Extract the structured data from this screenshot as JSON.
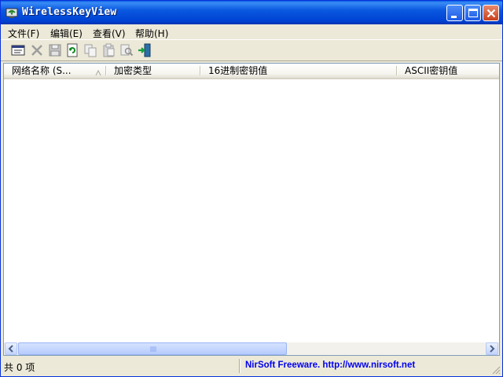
{
  "window": {
    "title": "WirelessKeyView",
    "app_icon": "wireless-key-icon",
    "title_color": "#0054e3"
  },
  "menu": {
    "items": [
      {
        "label": "文件(F)"
      },
      {
        "label": "编辑(E)"
      },
      {
        "label": "查看(V)"
      },
      {
        "label": "帮助(H)"
      }
    ]
  },
  "toolbar": {
    "icons": [
      "properties-icon",
      "delete-icon",
      "save-icon",
      "refresh-icon",
      "copy-icon",
      "clipboard-icon",
      "find-icon",
      "exit-icon"
    ]
  },
  "table": {
    "columns": [
      {
        "label": "网络名称 (S..."
      },
      {
        "label": "加密类型"
      },
      {
        "label": "16进制密钥值"
      },
      {
        "label": "ASCII密钥值"
      }
    ],
    "rows": []
  },
  "status": {
    "count_text": "共 0 项",
    "link_text": "NirSoft Freeware.  http://www.nirsoft.net",
    "link_color": "#0000ee"
  }
}
